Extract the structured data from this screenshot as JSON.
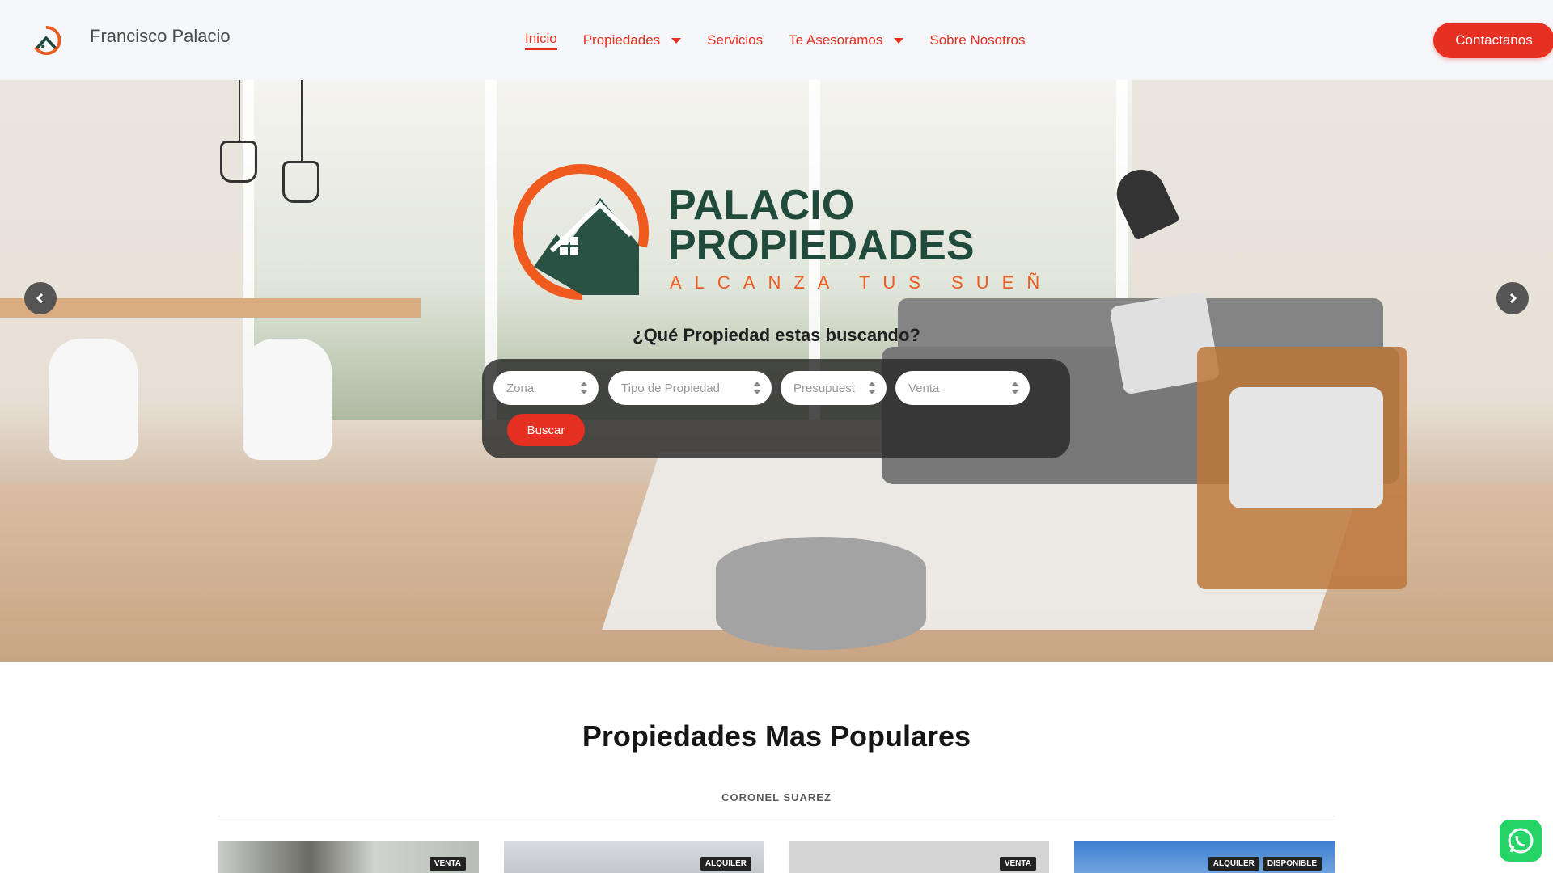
{
  "header": {
    "brand_name": "Francisco Palacio",
    "logo_icon": "house-logo-icon",
    "nav": [
      {
        "label": "Inicio",
        "active": true,
        "dropdown": false
      },
      {
        "label": "Propiedades",
        "active": false,
        "dropdown": true
      },
      {
        "label": "Servicios",
        "active": false,
        "dropdown": false
      },
      {
        "label": "Te Asesoramos",
        "active": false,
        "dropdown": true
      },
      {
        "label": "Sobre Nosotros",
        "active": false,
        "dropdown": false
      }
    ],
    "contact_label": "Contactanos"
  },
  "hero": {
    "logo_line1": "PALACIO",
    "logo_line2": "PROPIEDADES",
    "logo_tagline": "ALCANZA TUS SUEÑOS",
    "question": "¿Qué Propiedad estas buscando?",
    "search": {
      "zona_placeholder": "Zona",
      "tipo_placeholder": "Tipo de Propiedad",
      "presupuesto_placeholder": "Presupuest",
      "operacion_value": "Venta",
      "buscar_label": "Buscar"
    },
    "prev_icon": "chevron-left-icon",
    "next_icon": "chevron-right-icon"
  },
  "section": {
    "title": "Propiedades Mas Populares",
    "tab": "CORONEL SUAREZ",
    "cards": [
      {
        "badges": [
          "VENTA"
        ]
      },
      {
        "badges": [
          "ALQUILER"
        ]
      },
      {
        "badges": [
          "VENTA"
        ]
      },
      {
        "badges": [
          "ALQUILER",
          "DISPONIBLE"
        ]
      }
    ]
  },
  "colors": {
    "accent": "#e53022",
    "brand_green": "#1f4a3c",
    "brand_orange": "#ef5a1f"
  },
  "whatsapp_icon": "whatsapp-icon"
}
